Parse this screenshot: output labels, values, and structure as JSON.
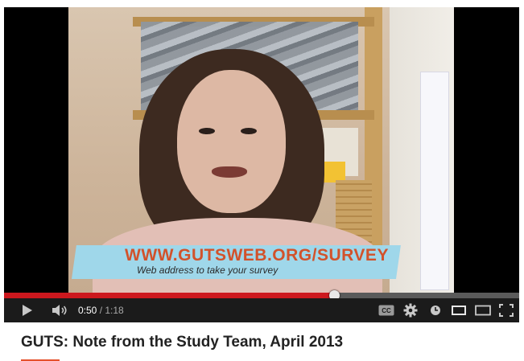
{
  "player": {
    "overlay": {
      "url_text": "WWW.GUTSWEB.ORG/SURVEY",
      "subtitle_text": "Web address to take your survey"
    },
    "controls": {
      "current_time": "0:50",
      "separator": " / ",
      "duration": "1:18",
      "progress": 0.641,
      "icons": [
        "play-icon",
        "volume-icon",
        "cc-icon",
        "gear-icon",
        "watch-later-icon",
        "small-player-icon",
        "large-player-icon",
        "fullscreen-icon"
      ]
    },
    "colors": {
      "progress": "#cc181e",
      "accent": "#e5502b",
      "controls_bg": "#1b1b1b"
    }
  },
  "video_title": "GUTS: Note from the Study Team, April 2013"
}
